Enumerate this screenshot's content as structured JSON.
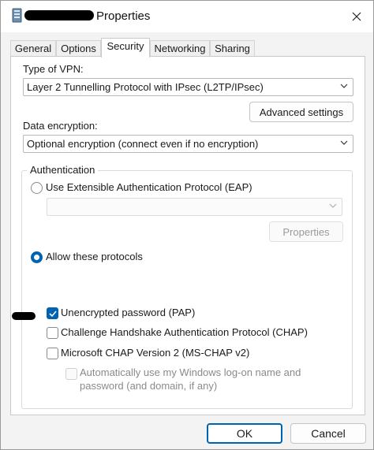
{
  "window": {
    "title": "Properties",
    "title_icon": "network-connection-icon",
    "close_icon": "close-icon"
  },
  "tabs": [
    {
      "label": "General",
      "active": false
    },
    {
      "label": "Options",
      "active": false
    },
    {
      "label": "Security",
      "active": true
    },
    {
      "label": "Networking",
      "active": false
    },
    {
      "label": "Sharing",
      "active": false
    }
  ],
  "security": {
    "vpn_type_label": "Type of VPN:",
    "vpn_type_value": "Layer 2 Tunnelling Protocol with IPsec (L2TP/IPsec)",
    "advanced_settings_label": "Advanced settings",
    "data_encryption_label": "Data encryption:",
    "data_encryption_value": "Optional encryption (connect even if no encryption)",
    "authentication_label": "Authentication",
    "eap_option_label": "Use Extensible Authentication Protocol (EAP)",
    "eap_option_selected": false,
    "eap_method_value": "",
    "eap_properties_label": "Properties",
    "allow_protocols_label": "Allow these protocols",
    "allow_protocols_selected": true,
    "protocols": {
      "pap": {
        "label": "Unencrypted password (PAP)",
        "checked": true
      },
      "chap": {
        "label": "Challenge Handshake Authentication Protocol (CHAP)",
        "checked": false
      },
      "mschapv2": {
        "label": "Microsoft CHAP Version 2 (MS-CHAP v2)",
        "checked": false
      }
    },
    "auto_logon_line1": "Automatically use my Windows log-on name and",
    "auto_logon_line2": "password (and domain, if any)",
    "auto_logon_checked": false
  },
  "footer": {
    "ok_label": "OK",
    "cancel_label": "Cancel"
  },
  "colors": {
    "accent": "#0063b1",
    "window_bg": "#f3f3f3",
    "panel_bg": "#ffffff"
  }
}
